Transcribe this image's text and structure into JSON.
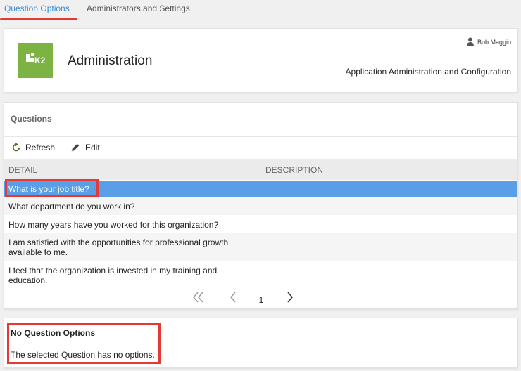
{
  "tabs": [
    {
      "label": "Question Options"
    },
    {
      "label": "Administrators and Settings"
    }
  ],
  "header": {
    "logo_text": "K2",
    "title": "Administration",
    "user_name": "Bob Maggio",
    "subtitle": "Application Administration and Configuration"
  },
  "questions": {
    "section_title": "Questions",
    "toolbar": {
      "refresh_label": "Refresh",
      "edit_label": "Edit"
    },
    "columns": {
      "detail": "DETAIL",
      "description": "DESCRIPTION"
    },
    "rows": [
      {
        "detail": "What is your job title?",
        "description": ""
      },
      {
        "detail": "What department do you work in?",
        "description": ""
      },
      {
        "detail": "How many years have you worked for this organization?",
        "description": ""
      },
      {
        "detail": "I am satisfied with the opportunities for professional growth available to me.",
        "description": ""
      },
      {
        "detail": "I feel that the organization is invested in my training and education.",
        "description": ""
      }
    ],
    "selected_row": "What is your job title?",
    "pager": {
      "page": "1"
    }
  },
  "options": {
    "title": "No Question Options",
    "message": "The selected Question has no options."
  },
  "colors": {
    "accent": "#3a8fd9",
    "selected_row": "#5b9ee8",
    "annotation": "#e53935",
    "logo_bg": "#7cb342"
  },
  "icons": {
    "refresh": "refresh-icon",
    "edit": "pencil-icon",
    "user": "user-icon",
    "first": "double-chevron-left-icon",
    "prev": "chevron-left-icon",
    "next": "chevron-right-icon"
  }
}
